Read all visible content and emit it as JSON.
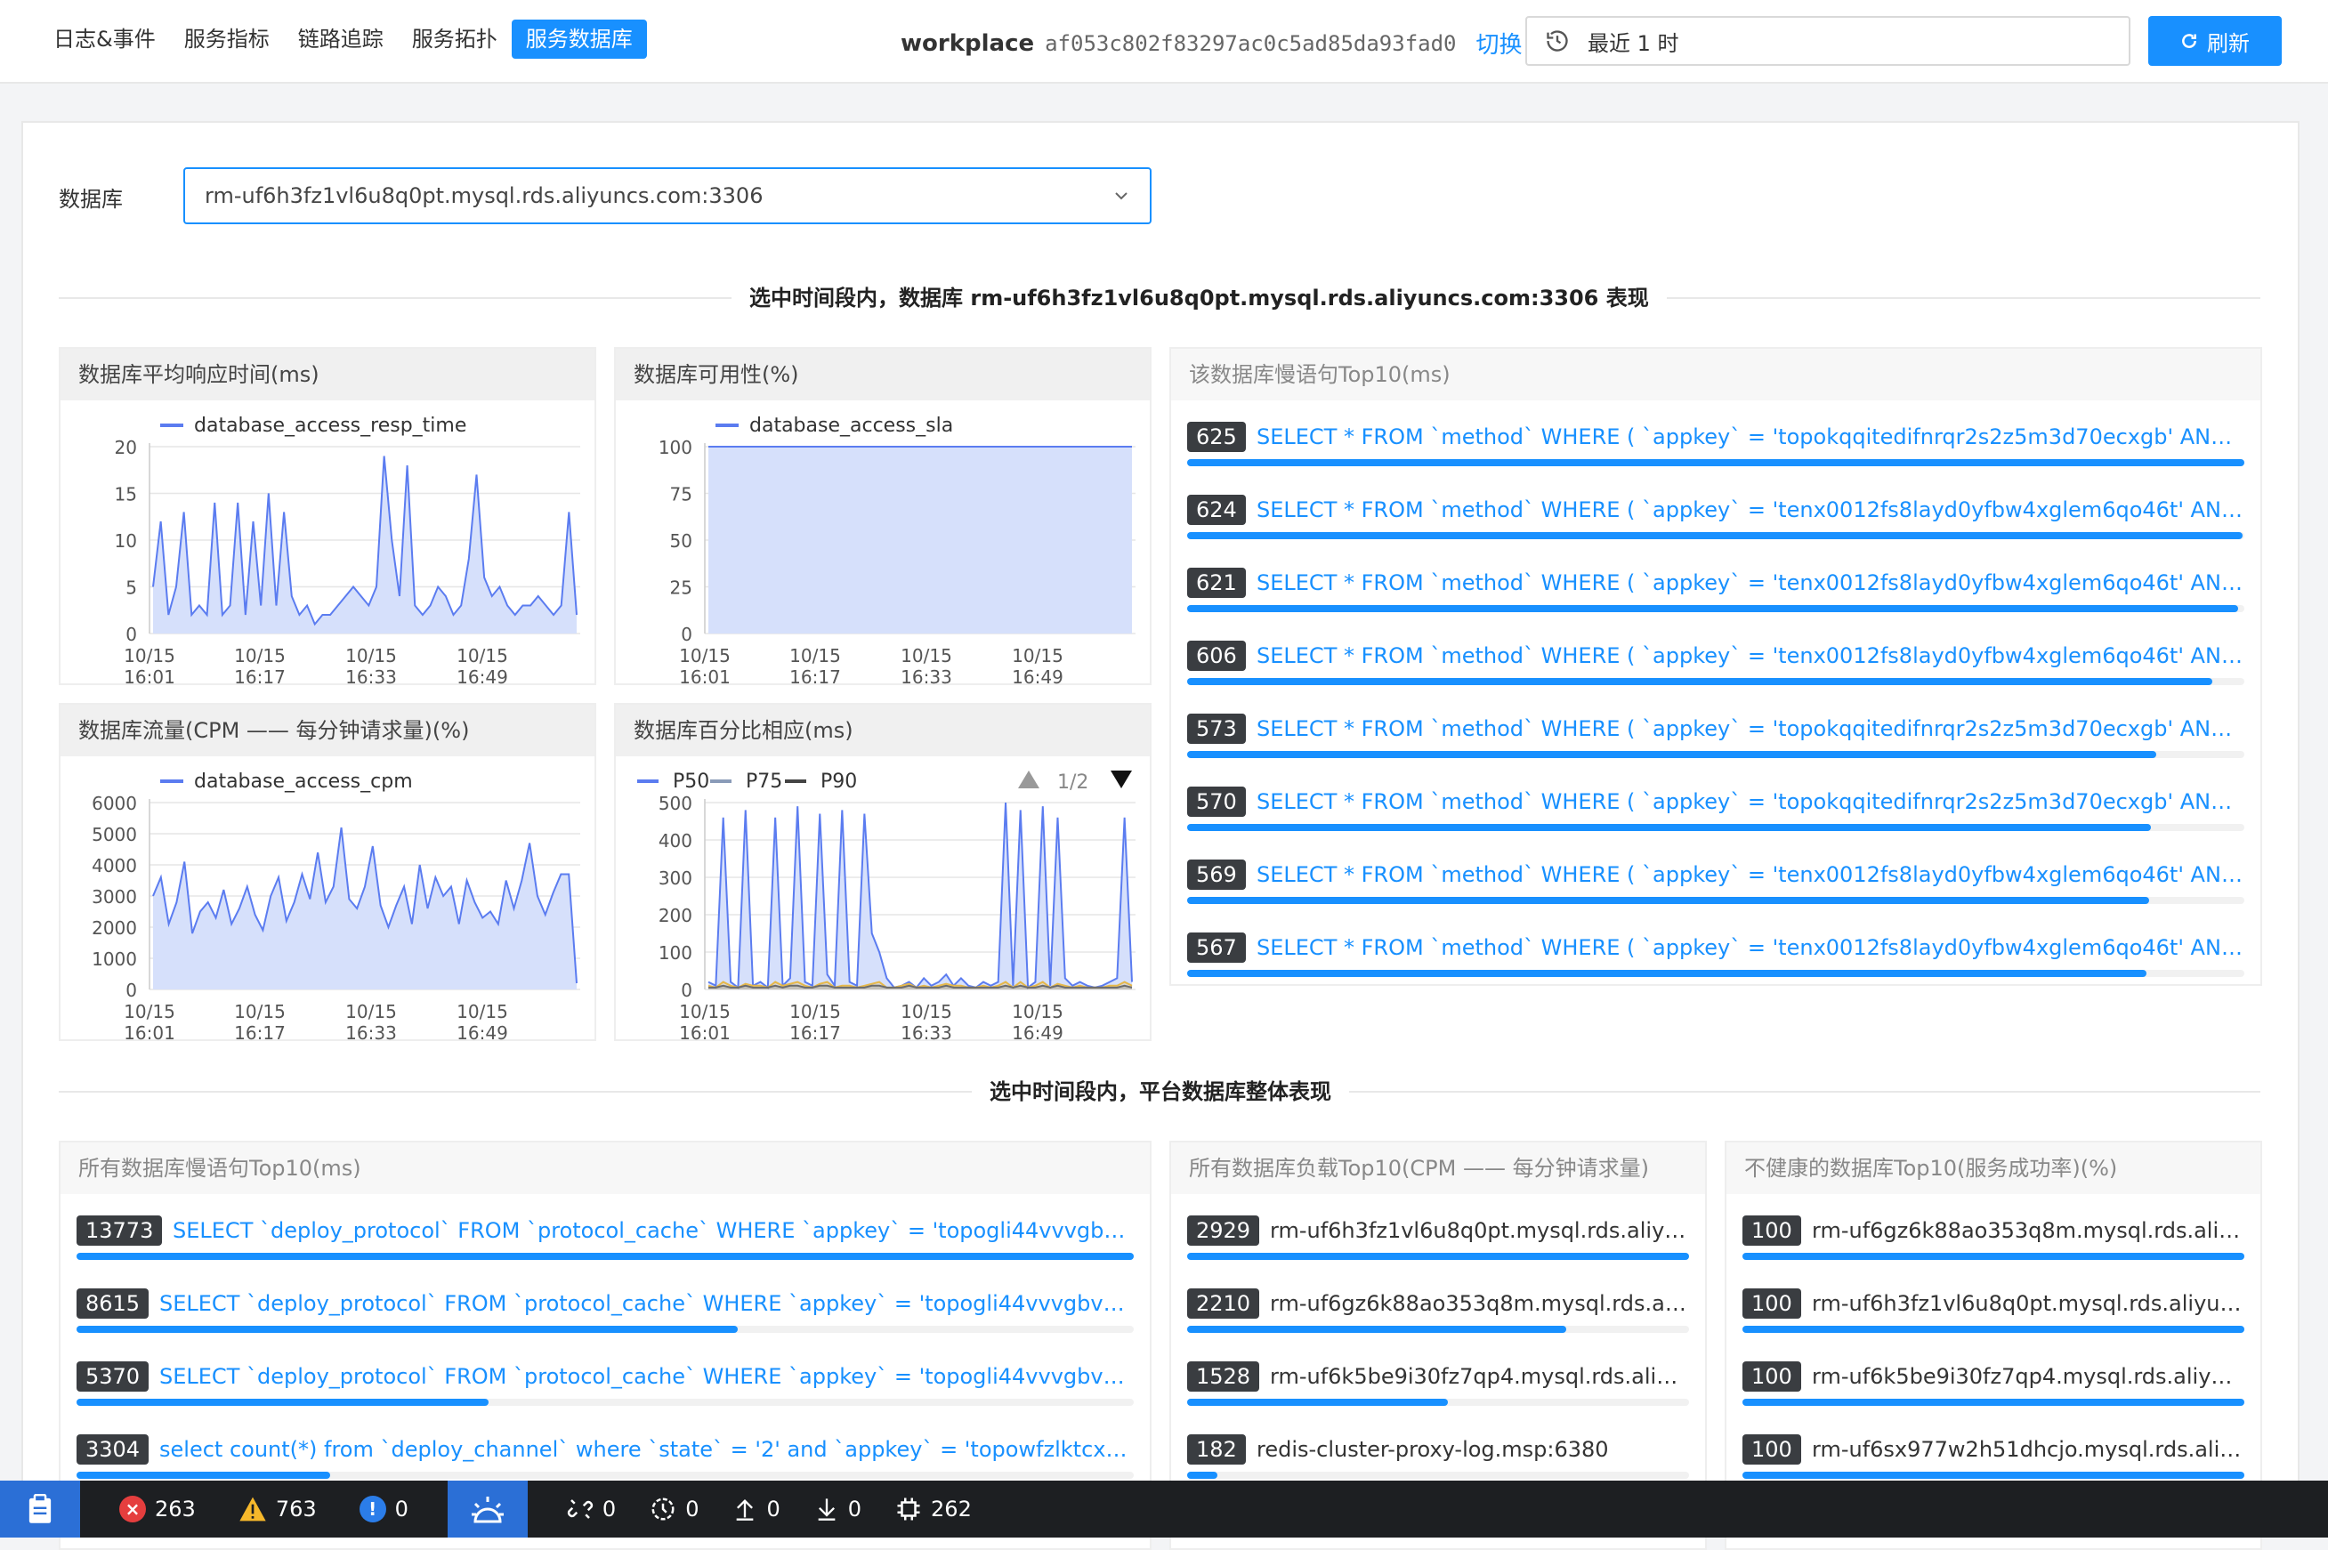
{
  "nav": {
    "tabs": [
      {
        "label": "日志&事件",
        "active": false
      },
      {
        "label": "服务指标",
        "active": false
      },
      {
        "label": "链路追踪",
        "active": false
      },
      {
        "label": "服务拓扑",
        "active": false
      },
      {
        "label": "服务数据库",
        "active": true
      }
    ]
  },
  "workspace": {
    "name": "workplace",
    "id": "af053c802f83297ac0c5ad85da93fad0",
    "switch_label": "切换"
  },
  "time": {
    "range": "最近 1 时"
  },
  "refresh": {
    "label": "刷新"
  },
  "db": {
    "label": "数据库",
    "selected": "rm-uf6h3fz1vl6u8q0pt.mysql.rds.aliyuncs.com:3306"
  },
  "section1_title": "选中时间段内，数据库 rm-uf6h3fz1vl6u8q0pt.mysql.rds.aliyuncs.com:3306 表现",
  "section2_title": "选中时间段内，平台数据库整体表现",
  "panels": {
    "resp_time": "数据库平均响应时间(ms)",
    "sla": "数据库可用性(%)",
    "slow_top": "该数据库慢语句Top10(ms)",
    "cpm": "数据库流量(CPM —— 每分钟请求量)(%)",
    "percentile": "数据库百分比相应(ms)",
    "all_slow": "所有数据库慢语句Top10(ms)",
    "all_load": "所有数据库负载Top10(CPM —— 每分钟请求量)",
    "unhealthy": "不健康的数据库Top10(服务成功率)(%)"
  },
  "chart_data": [
    {
      "type": "area",
      "series": [
        {
          "name": "database_access_resp_time",
          "values": [
            5,
            12,
            2,
            5,
            13,
            2,
            3,
            2,
            14,
            2,
            3,
            14,
            2,
            12,
            3,
            15,
            3,
            13,
            4,
            2,
            3,
            1,
            2,
            2,
            3,
            4,
            5,
            4,
            3,
            5,
            19,
            10,
            4,
            18,
            3,
            2,
            3,
            5,
            4,
            2,
            3,
            8,
            17,
            6,
            4,
            5,
            3,
            2,
            3,
            3,
            4,
            3,
            2,
            3,
            13,
            2
          ]
        }
      ],
      "x_ticks": [
        "10/15\n16:01",
        "10/15\n16:17",
        "10/15\n16:33",
        "10/15\n16:49"
      ],
      "yticks": [
        0,
        5,
        10,
        15,
        20
      ],
      "ylim": [
        0,
        20
      ]
    },
    {
      "type": "area",
      "series": [
        {
          "name": "database_access_sla",
          "values": [
            100,
            100,
            100,
            100,
            100,
            100,
            100,
            100,
            100,
            100,
            100,
            100,
            100,
            100,
            100,
            100,
            100,
            100,
            100,
            100,
            100,
            100,
            100,
            100,
            100,
            100,
            100,
            100,
            100,
            100,
            100,
            100,
            100,
            100,
            100,
            100,
            100,
            100,
            100,
            100,
            100,
            100,
            100,
            100,
            100,
            100,
            100,
            100,
            100,
            100,
            100,
            100,
            100,
            100,
            100,
            100
          ]
        }
      ],
      "x_ticks": [
        "10/15\n16:01",
        "10/15\n16:17",
        "10/15\n16:33",
        "10/15\n16:49"
      ],
      "yticks": [
        0,
        25,
        50,
        75,
        100
      ],
      "ylim": [
        0,
        100
      ]
    },
    {
      "type": "area",
      "series": [
        {
          "name": "database_access_cpm",
          "values": [
            3000,
            3600,
            2100,
            2800,
            4100,
            1800,
            2500,
            2800,
            2300,
            3200,
            2100,
            2600,
            3300,
            2400,
            1900,
            3000,
            3600,
            2200,
            2800,
            3700,
            2900,
            4400,
            2800,
            3300,
            5200,
            2900,
            2600,
            3300,
            4600,
            2700,
            2000,
            2700,
            3300,
            2100,
            4000,
            2600,
            3600,
            3000,
            3300,
            2100,
            3500,
            2800,
            2300,
            2500,
            2100,
            3500,
            2600,
            3500,
            4700,
            3000,
            2400,
            3100,
            3700,
            3700,
            200
          ]
        }
      ],
      "x_ticks": [
        "10/15\n16:01",
        "10/15\n16:17",
        "10/15\n16:33",
        "10/15\n16:49"
      ],
      "yticks": [
        0,
        1000,
        2000,
        3000,
        4000,
        5000,
        6000
      ],
      "ylim": [
        0,
        6000
      ]
    },
    {
      "type": "area",
      "legend": {
        "page": "1/2"
      },
      "series": [
        {
          "name": "P50",
          "values": [
            20,
            10,
            460,
            20,
            5,
            480,
            10,
            20,
            5,
            460,
            10,
            30,
            490,
            20,
            10,
            470,
            40,
            10,
            480,
            20,
            10,
            470,
            150,
            100,
            30,
            5,
            10,
            20,
            5,
            30,
            10,
            20,
            40,
            10,
            30,
            10,
            5,
            20,
            10,
            20,
            500,
            10,
            480,
            5,
            20,
            490,
            10,
            460,
            30,
            10,
            20,
            10,
            5,
            10,
            20,
            30,
            460,
            20
          ]
        },
        {
          "name": "P75",
          "values": [
            10,
            5,
            20,
            10,
            5,
            15,
            10,
            10,
            5,
            20,
            10,
            15,
            20,
            10,
            5,
            15,
            20,
            5,
            10,
            10,
            5,
            10,
            15,
            20,
            5,
            5,
            10,
            15,
            5,
            10,
            5,
            10,
            15,
            10,
            10,
            5,
            5,
            10,
            5,
            10,
            20,
            5,
            20,
            5,
            10,
            20,
            5,
            15,
            10,
            5,
            10,
            5,
            5,
            5,
            10,
            10,
            20,
            10
          ]
        },
        {
          "name": "P90",
          "values": [
            5,
            5,
            10,
            5,
            5,
            10,
            5,
            5,
            5,
            10,
            5,
            10,
            10,
            5,
            5,
            10,
            10,
            5,
            5,
            5,
            5,
            5,
            10,
            10,
            5,
            5,
            5,
            10,
            5,
            5,
            5,
            5,
            10,
            5,
            5,
            5,
            5,
            5,
            5,
            5,
            10,
            5,
            10,
            5,
            5,
            10,
            5,
            10,
            5,
            5,
            5,
            5,
            5,
            5,
            5,
            5,
            10,
            5
          ]
        }
      ],
      "x_ticks": [
        "10/15\n16:01",
        "10/15\n16:17",
        "10/15\n16:33",
        "10/15\n16:49"
      ],
      "yticks": [
        0,
        100,
        200,
        300,
        400,
        500
      ],
      "ylim": [
        0,
        500
      ]
    }
  ],
  "slow_top": [
    {
      "value": "625",
      "sql": "SELECT * FROM `method` WHERE ( `appkey` = 'topokqqitedifnrqr2s2z5m3d70ecxgb' AND `ch...",
      "pct": 1.0
    },
    {
      "value": "624",
      "sql": "SELECT * FROM `method` WHERE ( `appkey` = 'tenx0012fs8layd0yfbw4xglem6qo46t' AND `c...",
      "pct": 0.998
    },
    {
      "value": "621",
      "sql": "SELECT * FROM `method` WHERE ( `appkey` = 'tenx0012fs8layd0yfbw4xglem6qo46t' AND `c...",
      "pct": 0.994
    },
    {
      "value": "606",
      "sql": "SELECT * FROM `method` WHERE ( `appkey` = 'tenx0012fs8layd0yfbw4xglem6qo46t' AND `c...",
      "pct": 0.97
    },
    {
      "value": "573",
      "sql": "SELECT * FROM `method` WHERE ( `appkey` = 'topokqqitedifnrqr2s2z5m3d70ecxgb' AND `ch...",
      "pct": 0.917
    },
    {
      "value": "570",
      "sql": "SELECT * FROM `method` WHERE ( `appkey` = 'topokqqitedifnrqr2s2z5m3d70ecxgb' AND `ch...",
      "pct": 0.912
    },
    {
      "value": "569",
      "sql": "SELECT * FROM `method` WHERE ( `appkey` = 'tenx0012fs8layd0yfbw4xglem6qo46t' AND `c...",
      "pct": 0.91
    },
    {
      "value": "567",
      "sql": "SELECT * FROM `method` WHERE ( `appkey` = 'tenx0012fs8layd0yfbw4xglem6qo46t' AND `c...",
      "pct": 0.907
    }
  ],
  "all_slow": [
    {
      "value": "13773",
      "sql": "SELECT `deploy_protocol` FROM `protocol_cache` WHERE `appkey` = 'topogli44vvvgbvkoh...",
      "pct": 1.0
    },
    {
      "value": "8615",
      "sql": "SELECT `deploy_protocol` FROM `protocol_cache` WHERE `appkey` = 'topogli44vvvgbvkoho...",
      "pct": 0.625
    },
    {
      "value": "5370",
      "sql": "SELECT `deploy_protocol` FROM `protocol_cache` WHERE `appkey` = 'topogli44vvvgbvkoho...",
      "pct": 0.39
    },
    {
      "value": "3304",
      "sql": "select count(*) from `deploy_channel` where `state` = '2' and `appkey` = 'topowfzlktcx8mdk...",
      "pct": 0.24
    }
  ],
  "all_load": [
    {
      "value": "2929",
      "db": "rm-uf6h3fz1vl6u8q0pt.mysql.rds.aliyu...",
      "pct": 1.0
    },
    {
      "value": "2210",
      "db": "rm-uf6gz6k88ao353q8m.mysql.rds.ali...",
      "pct": 0.755
    },
    {
      "value": "1528",
      "db": "rm-uf6k5be9i30fz7qp4.mysql.rds.aliyu...",
      "pct": 0.52
    },
    {
      "value": "182",
      "db": "redis-cluster-proxy-log.msp:6380",
      "pct": 0.06
    }
  ],
  "unhealthy": [
    {
      "value": "100",
      "db": "rm-uf6gz6k88ao353q8m.mysql.rds.aliyu...",
      "pct": 1.0
    },
    {
      "value": "100",
      "db": "rm-uf6h3fz1vl6u8q0pt.mysql.rds.aliyun...",
      "pct": 1.0
    },
    {
      "value": "100",
      "db": "rm-uf6k5be9i30fz7qp4.mysql.rds.aliyun...",
      "pct": 1.0
    },
    {
      "value": "100",
      "db": "rm-uf6sx977w2h51dhcjo.mysql.rds.aliy...",
      "pct": 1.0
    }
  ],
  "statusbar": {
    "errors": "263",
    "warnings": "763",
    "info": "0",
    "broken_links": "0",
    "timers": "0",
    "uploads": "0",
    "downloads": "0",
    "memory": "262"
  },
  "colors": {
    "accent": "#1890ff",
    "series_blue": "#5b7cf0",
    "area_fill": "#d6e0fb"
  }
}
